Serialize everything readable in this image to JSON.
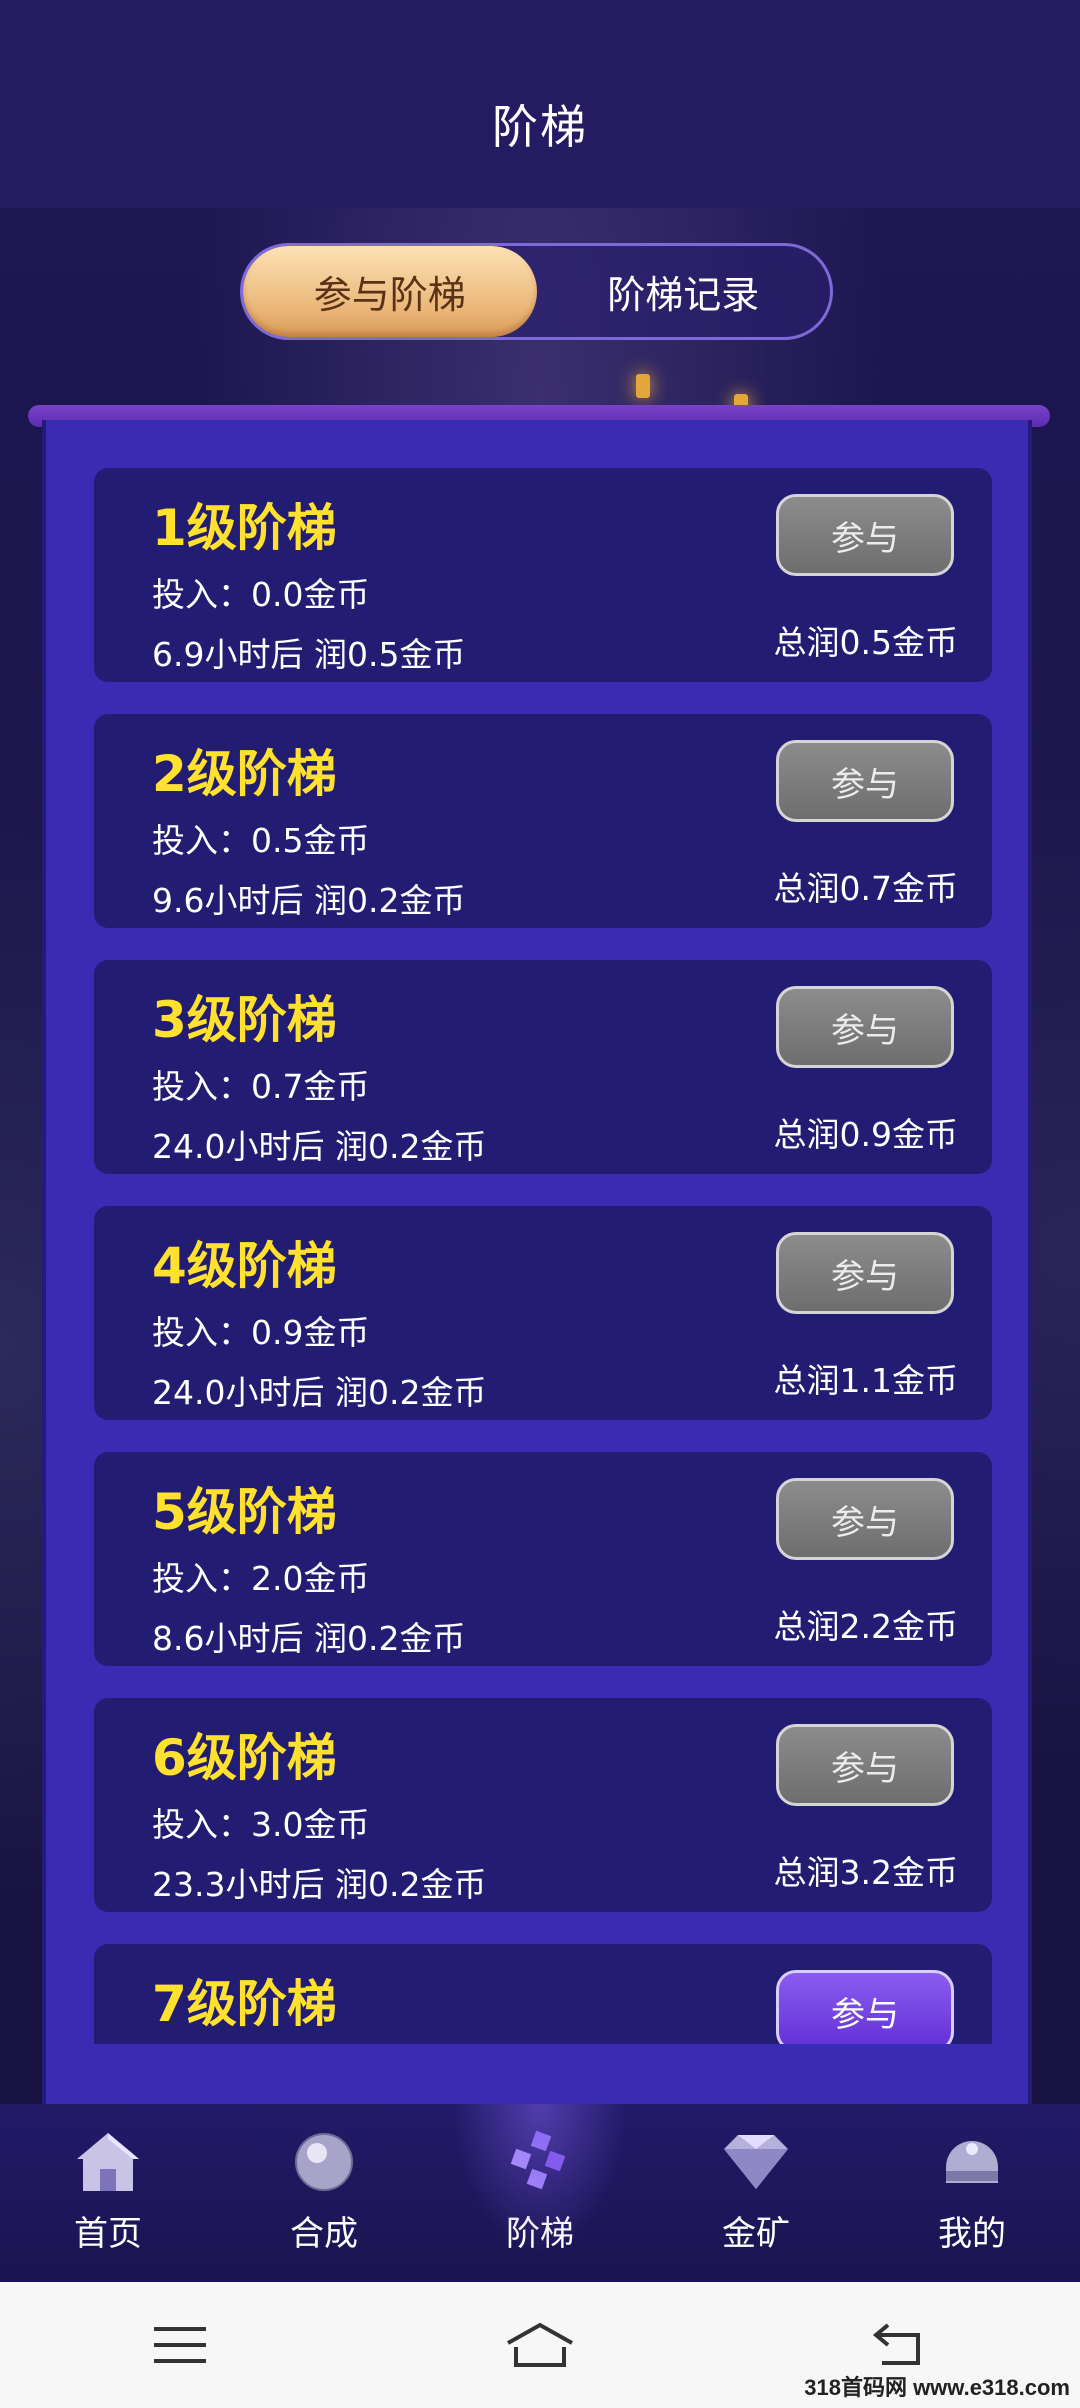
{
  "header": {
    "title": "阶梯"
  },
  "tabs": [
    {
      "label": "参与阶梯",
      "active": true
    },
    {
      "label": "阶梯记录",
      "active": false
    }
  ],
  "ladders": [
    {
      "name": "1级阶梯",
      "invest": "投入：0.0金币",
      "after": "6.9小时后 润0.5金币",
      "button": "参与",
      "total": "总润0.5金币"
    },
    {
      "name": "2级阶梯",
      "invest": "投入：0.5金币",
      "after": "9.6小时后 润0.2金币",
      "button": "参与",
      "total": "总润0.7金币"
    },
    {
      "name": "3级阶梯",
      "invest": "投入：0.7金币",
      "after": "24.0小时后 润0.2金币",
      "button": "参与",
      "total": "总润0.9金币"
    },
    {
      "name": "4级阶梯",
      "invest": "投入：0.9金币",
      "after": "24.0小时后 润0.2金币",
      "button": "参与",
      "total": "总润1.1金币"
    },
    {
      "name": "5级阶梯",
      "invest": "投入：2.0金币",
      "after": "8.6小时后 润0.2金币",
      "button": "参与",
      "total": "总润2.2金币"
    },
    {
      "name": "6级阶梯",
      "invest": "投入：3.0金币",
      "after": "23.3小时后 润0.2金币",
      "button": "参与",
      "total": "总润3.2金币"
    },
    {
      "name": "7级阶梯",
      "invest": "",
      "after": "",
      "button": "参与",
      "total": ""
    }
  ],
  "nav": [
    {
      "label": "首页",
      "icon": "home-icon"
    },
    {
      "label": "合成",
      "icon": "orb-icon"
    },
    {
      "label": "阶梯",
      "icon": "cubes-icon",
      "active": true
    },
    {
      "label": "金矿",
      "icon": "diamond-icon"
    },
    {
      "label": "我的",
      "icon": "helmet-icon"
    }
  ],
  "watermark": "318首码网 www.e318.com",
  "colors": {
    "accent_yellow": "#ffe12e",
    "panel": "#3a2cb2",
    "card": "#231c73",
    "active_button": "#6f42e0"
  }
}
